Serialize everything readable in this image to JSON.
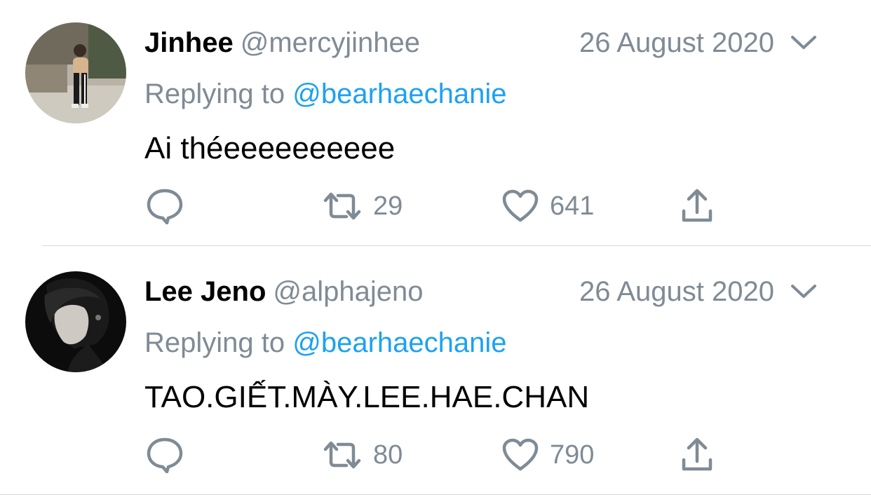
{
  "tweets": [
    {
      "name": "Jinhee",
      "handle": "@mercyjinhee",
      "date": "26 August 2020",
      "replying_prefix": "Replying to",
      "replying_to": "@bearhaechanie",
      "text": "Ai théeeeeeeeeee",
      "retweets": "29",
      "likes": "641",
      "avatar_icon": "profile-photo"
    },
    {
      "name": "Lee Jeno",
      "handle": "@alphajeno",
      "date": "26 August 2020",
      "replying_prefix": "Replying to",
      "replying_to": "@bearhaechanie",
      "text": "TAO.GIẾT.MÀY.LEE.HAE.CHAN",
      "retweets": "80",
      "likes": "790",
      "avatar_icon": "profile-photo"
    }
  ],
  "icons": {
    "reply": "reply-icon",
    "retweet": "retweet-icon",
    "like": "heart-icon",
    "share": "share-icon",
    "menu": "chevron-down-icon"
  },
  "colors": {
    "accent": "#1da1f2",
    "muted": "#7f8b95",
    "text": "#000000",
    "divider": "#d9d9d9"
  }
}
